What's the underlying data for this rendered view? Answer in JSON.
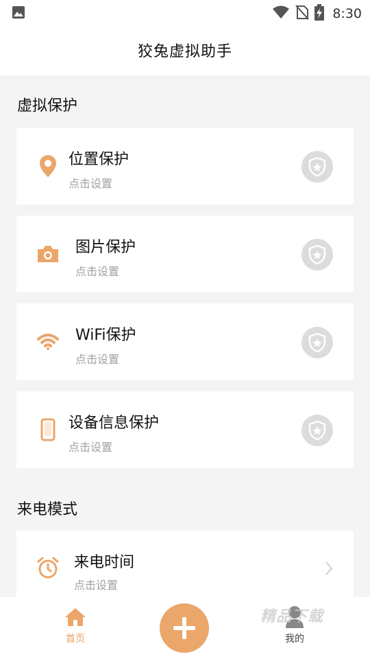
{
  "status_bar": {
    "time": "8:30",
    "icons": [
      "image-icon",
      "wifi-icon",
      "no-sim-icon",
      "battery-charging-icon"
    ]
  },
  "app_bar": {
    "title": "狡兔虚拟助手"
  },
  "sections": {
    "protection": {
      "title": "虚拟保护",
      "items": [
        {
          "title": "位置保护",
          "subtitle": "点击设置",
          "icon": "location-pin-icon"
        },
        {
          "title": "图片保护",
          "subtitle": "点击设置",
          "icon": "camera-icon"
        },
        {
          "title": "WiFi保护",
          "subtitle": "点击设置",
          "icon": "wifi-icon"
        },
        {
          "title": "设备信息保护",
          "subtitle": "点击设置",
          "icon": "phone-device-icon"
        }
      ]
    },
    "call_mode": {
      "title": "来电模式",
      "items": [
        {
          "title": "来电时间",
          "subtitle": "点击设置",
          "icon": "alarm-clock-icon"
        }
      ]
    }
  },
  "bottom_nav": {
    "home_label": "首页",
    "mine_label": "我的",
    "fab_icon": "plus-icon"
  },
  "watermark": "精品下载",
  "colors": {
    "accent": "#eba66a",
    "shield_bg": "#dcdcdc",
    "background": "#f4f4f4",
    "subtitle": "#a0a0a0"
  }
}
